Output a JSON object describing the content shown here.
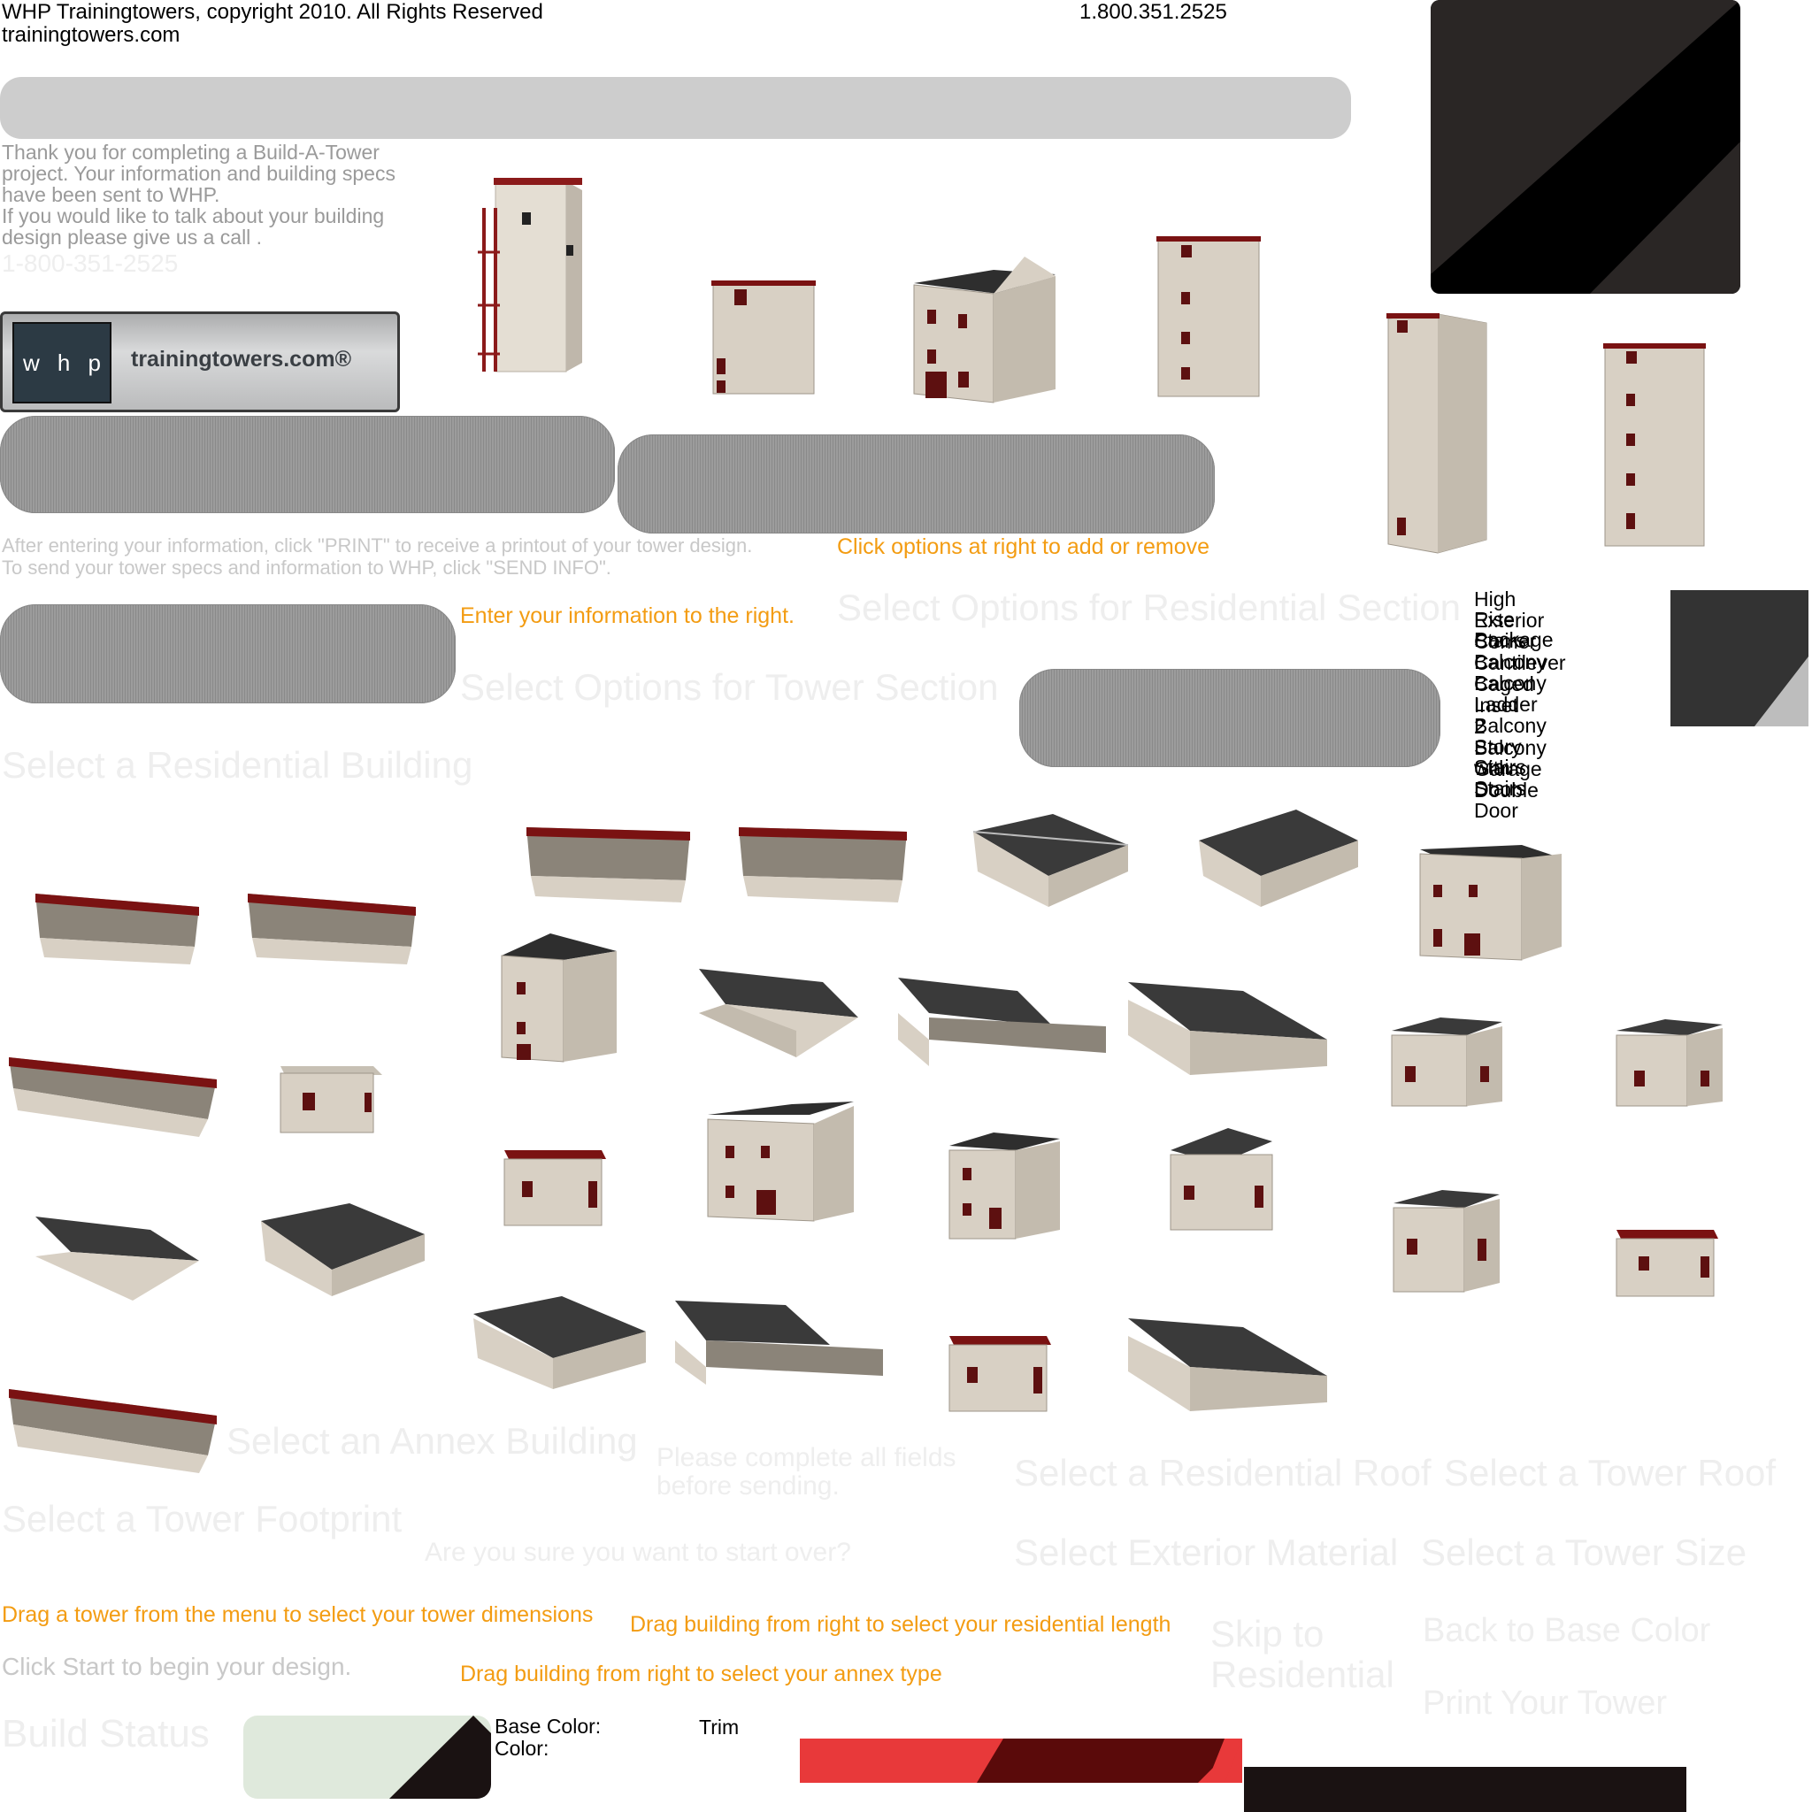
{
  "header": {
    "copyright": "WHP Trainingtowers, copyright 2010. All Rights Reserved",
    "site": "trainingtowers.com",
    "phone": "1.800.351.2525"
  },
  "thankyou": {
    "text": "Thank you for completing a Build-A-Tower project. Your information and building specs have been sent to WHP.\nIf you would like to talk about your building design please give us a call .",
    "phone_ghost": "1-800-351-2525"
  },
  "logo": {
    "letters": [
      "w",
      "h",
      "p"
    ],
    "domain": "trainingtowers.com®"
  },
  "instructions": {
    "print_line": "After entering your information, click  \"PRINT\" to receive a printout of your tower design.",
    "send_line": "To send your tower specs and information to WHP, click \"SEND INFO\".",
    "click_options": "Click options at right to add or remove",
    "enter_info": "Enter your information to the right.",
    "drag_tower": "Drag a tower from the menu to select your tower dimensions",
    "drag_residential": "Drag building from right to select your residential length",
    "drag_annex": "Drag building from right to select your annex type",
    "click_start": "Click Start to begin your design."
  },
  "ghost_headings": {
    "residential_section": "Select Options for Residential Section",
    "tower_section": "Select Options for Tower Section",
    "residential_building": "Select a Residential Building",
    "annex_building": "Select an Annex Building",
    "complete_fields": "Please complete all fields\nbefore sending.",
    "residential_roof": "Select a Residential Roof",
    "tower_roof": "Select a Tower Roof",
    "tower_footprint": "Select a Tower Footprint",
    "start_over": "Are you sure you want to start over?",
    "exterior_material": "Select Exterior Material",
    "tower_size": "Select a Tower Size",
    "skip_residential": "Skip to\nResidential",
    "back_base_color": "Back to Base Color",
    "print_tower": "Print Your Tower",
    "build_status": "Build Status"
  },
  "options": [
    "High Rise Package",
    "Exterior Stairs",
    "Corner Balcony",
    "Cantilever Balcony",
    "Caged Ladder",
    "Inset Balcony",
    "2 Story Stairs",
    "Balcony with Stairs",
    "Garage Door",
    "Double Door"
  ],
  "colors": {
    "base_color_label": "Base Color:",
    "trim_label": "Trim\nColor:"
  },
  "palette": {
    "wall": "#d8d0c4",
    "trim": "#7a1212",
    "roof": "#3a3a3a",
    "orange": "#f39c12"
  }
}
